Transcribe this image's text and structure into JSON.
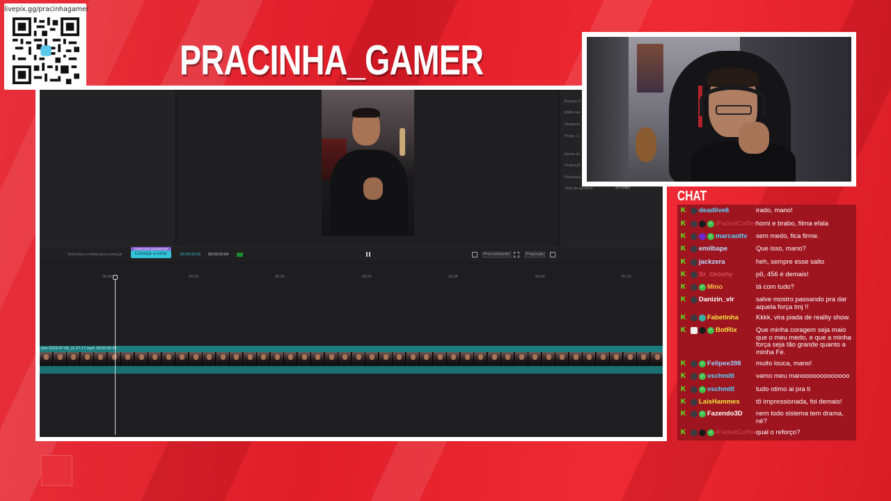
{
  "colors": {
    "background": "#e01e2a",
    "chat_background": "#9e1520",
    "kick_green": "#53fc18",
    "accent_cyan": "#34c3d6"
  },
  "qr": {
    "url": "livepix.gg/pracinhagamer"
  },
  "channel": {
    "title": "PRACINHA_GAMER"
  },
  "editor": {
    "properties": [
      "Espaço d",
      "Mídia lea",
      "Organiza",
      "Proxy: C",
      "Nome do",
      "Proporçã",
      "Resoluçã"
    ],
    "frame_rate_label": "Taxa de quadros:",
    "frame_rate_value": "30.00fps",
    "media_hint": "Selecione a mídia para começar",
    "cut_badge": "Experimente gratuitamente",
    "cut_button": "Começar a cortar",
    "timecode_current": "00:00:20:09",
    "timecode_total": "00:03:03:04",
    "fill_label": "Preenchimento",
    "ratio_label": "Proporção",
    "ruler_ticks": [
      "00:00",
      "00:20",
      "00:24",
      "00:26",
      "00:28",
      "00:30",
      "00:32"
    ],
    "clip_name": "ptbr-2026-07-08_11-27-17.mp4",
    "clip_duration": "00:00:45:24"
  },
  "chat": {
    "title": "CHAT",
    "messages": [
      {
        "user": "deadlive6",
        "user_color": "#53d7ff",
        "text": "irado, mano!",
        "badges": [
          "avatar"
        ],
        "verified": false
      },
      {
        "user": "iFadedCoffee",
        "user_color": "#c43a44",
        "text": "homi e brabo, filma efala",
        "badges": [
          "avatar",
          "mod"
        ],
        "verified": true
      },
      {
        "user": "marcaottv",
        "user_color": "#53d7ff",
        "text": "sem medo, fica firme.",
        "badges": [
          "avatar",
          "sub"
        ],
        "verified": true
      },
      {
        "user": "emilbape",
        "user_color": "#b8e0ff",
        "text": "Que isso, mano?",
        "badges": [
          "avatar"
        ],
        "verified": false
      },
      {
        "user": "jackzera",
        "user_color": "#b8e0ff",
        "text": "heh, sempre esse salto",
        "badges": [
          "avatar"
        ],
        "verified": false
      },
      {
        "user": "Sr_Oroshy",
        "user_color": "#d84a5a",
        "text": "pô, 456 é demais!",
        "badges": [
          "avatar"
        ],
        "verified": false
      },
      {
        "user": "Mino",
        "user_color": "#f5c242",
        "text": "tá com tudo?",
        "badges": [
          "avatar"
        ],
        "verified": true
      },
      {
        "user": "Danizin_vlr",
        "user_color": "#ffffff",
        "text": "salve mostro passando pra dar aquela força tmj !!",
        "badges": [
          "avatar"
        ],
        "verified": false
      },
      {
        "user": "Fabetinha",
        "user_color": "#f5e642",
        "text": "Kkkk, vira piada de reality show.",
        "badges": [
          "avatar",
          "badge"
        ],
        "verified": false
      },
      {
        "user": "BotRix",
        "user_color": "#f5e642",
        "text": "Que minha coragem seja maio que o meu medo, e que a minha força seja tão grande quanto a minha Fé.",
        "badges": [
          "bot",
          "mod"
        ],
        "verified": true
      },
      {
        "user": "Felipee398",
        "user_color": "#9ad0ff",
        "text": "muito louca, mano!",
        "badges": [
          "avatar"
        ],
        "verified": true
      },
      {
        "user": "vschmitt",
        "user_color": "#53d7ff",
        "text": "vamo meu manooooooooooooo",
        "badges": [
          "avatar"
        ],
        "verified": true
      },
      {
        "user": "vschmitt",
        "user_color": "#53d7ff",
        "text": "tudo otimo ai pra ti",
        "badges": [
          "avatar"
        ],
        "verified": true
      },
      {
        "user": "LaisHammes",
        "user_color": "#f5e642",
        "text": "tô impressionada, foi demais!",
        "badges": [
          "avatar"
        ],
        "verified": false
      },
      {
        "user": "Fazendo3D",
        "user_color": "#ffffff",
        "text": "nem todo sistema tem drama, né?",
        "badges": [
          "avatar"
        ],
        "verified": true
      },
      {
        "user": "iFadedCoffee",
        "user_color": "#c43a44",
        "text": "qual o reforço?",
        "badges": [
          "avatar",
          "mod"
        ],
        "verified": true
      }
    ]
  }
}
